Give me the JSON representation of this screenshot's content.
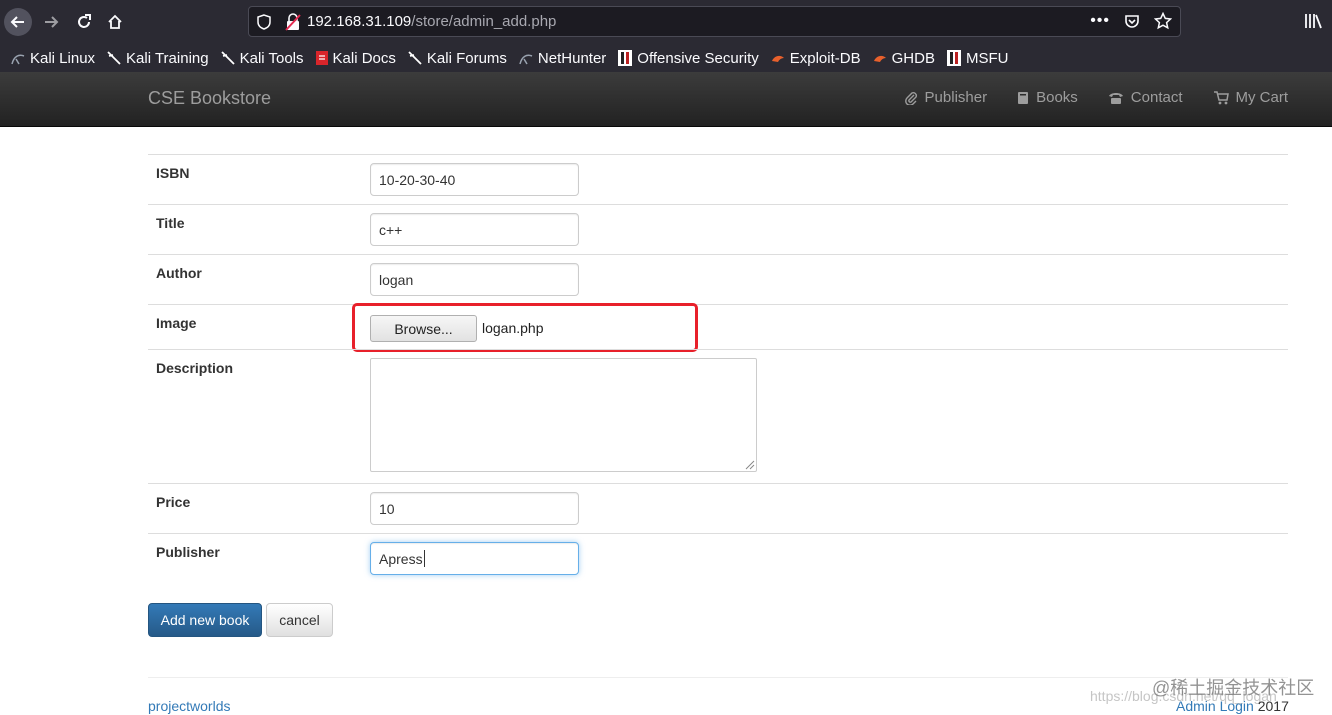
{
  "browser": {
    "url_host": "192.168.31.109",
    "url_path": "/store/admin_add.php"
  },
  "bookmarks": [
    {
      "label": "Kali Linux",
      "icon": "kali-dragon-icon"
    },
    {
      "label": "Kali Training",
      "icon": "kali-dragon-icon"
    },
    {
      "label": "Kali Tools",
      "icon": "kali-dragon-icon"
    },
    {
      "label": "Kali Docs",
      "icon": "kali-docs-icon"
    },
    {
      "label": "Kali Forums",
      "icon": "kali-dragon-icon"
    },
    {
      "label": "NetHunter",
      "icon": "nethunter-icon"
    },
    {
      "label": "Offensive Security",
      "icon": "offsec-icon"
    },
    {
      "label": "Exploit-DB",
      "icon": "exploitdb-icon"
    },
    {
      "label": "GHDB",
      "icon": "ghdb-icon"
    },
    {
      "label": "MSFU",
      "icon": "msfu-icon"
    }
  ],
  "site": {
    "brand": "CSE Bookstore",
    "nav": [
      {
        "label": "Publisher",
        "icon": "paperclip-icon"
      },
      {
        "label": "Books",
        "icon": "book-icon"
      },
      {
        "label": "Contact",
        "icon": "phone-icon"
      },
      {
        "label": "My Cart",
        "icon": "cart-icon"
      }
    ]
  },
  "form": {
    "isbn_label": "ISBN",
    "isbn_value": "10-20-30-40",
    "title_label": "Title",
    "title_value": "c++",
    "author_label": "Author",
    "author_value": "logan",
    "image_label": "Image",
    "browse_label": "Browse...",
    "image_file": "logan.php",
    "description_label": "Description",
    "description_value": "",
    "price_label": "Price",
    "price_value": "10",
    "publisher_label": "Publisher",
    "publisher_value": "Apress",
    "submit_label": "Add new book",
    "cancel_label": "cancel"
  },
  "footer": {
    "left": "projectworlds",
    "admin_link": "Admin Login",
    "year": "2017"
  },
  "watermark": {
    "url": "https://blog.csdn.net/qq_logan",
    "text": "@稀土掘金技术社区"
  },
  "colors": {
    "highlight": "#e8202a",
    "primary": "#337ab7"
  }
}
